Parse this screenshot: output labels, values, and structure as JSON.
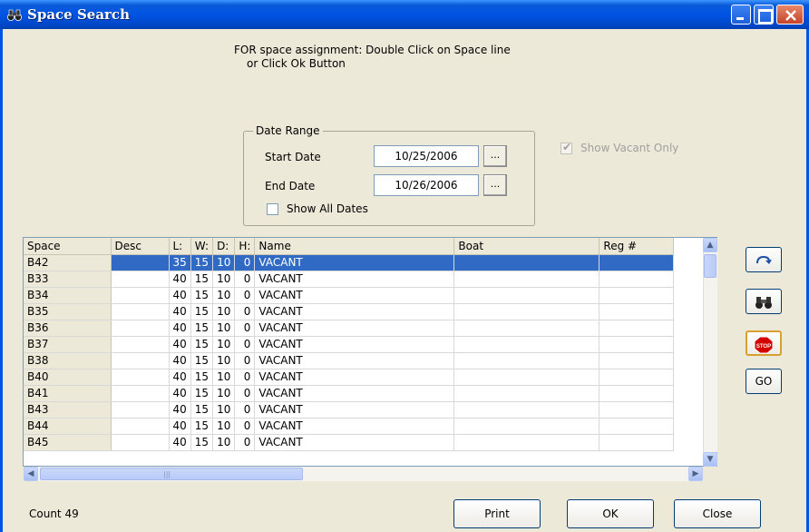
{
  "window": {
    "title": "Space Search"
  },
  "instructions": {
    "line1": "FOR space assignment: Double Click on Space line",
    "line2": "or Click Ok Button"
  },
  "date_range": {
    "legend": "Date Range",
    "start_label": "Start Date",
    "start_value": "10/25/2006",
    "end_label": "End Date",
    "end_value": "10/26/2006",
    "picker_label": "...",
    "show_all_dates_label": "Show All Dates",
    "show_all_dates_checked": false
  },
  "show_vacant_only": {
    "label": "Show Vacant Only",
    "checked": true,
    "disabled": true
  },
  "grid": {
    "columns": [
      "Space",
      "Desc",
      "L:",
      "W:",
      "D:",
      "H:",
      "Name",
      "Boat",
      "Reg #"
    ],
    "selected_row": 0,
    "rows": [
      [
        "B42",
        "",
        "35",
        "15",
        "10",
        "0",
        "VACANT",
        "",
        ""
      ],
      [
        "B33",
        "",
        "40",
        "15",
        "10",
        "0",
        "VACANT",
        "",
        ""
      ],
      [
        "B34",
        "",
        "40",
        "15",
        "10",
        "0",
        "VACANT",
        "",
        ""
      ],
      [
        "B35",
        "",
        "40",
        "15",
        "10",
        "0",
        "VACANT",
        "",
        ""
      ],
      [
        "B36",
        "",
        "40",
        "15",
        "10",
        "0",
        "VACANT",
        "",
        ""
      ],
      [
        "B37",
        "",
        "40",
        "15",
        "10",
        "0",
        "VACANT",
        "",
        ""
      ],
      [
        "B38",
        "",
        "40",
        "15",
        "10",
        "0",
        "VACANT",
        "",
        ""
      ],
      [
        "B40",
        "",
        "40",
        "15",
        "10",
        "0",
        "VACANT",
        "",
        ""
      ],
      [
        "B41",
        "",
        "40",
        "15",
        "10",
        "0",
        "VACANT",
        "",
        ""
      ],
      [
        "B43",
        "",
        "40",
        "15",
        "10",
        "0",
        "VACANT",
        "",
        ""
      ],
      [
        "B44",
        "",
        "40",
        "15",
        "10",
        "0",
        "VACANT",
        "",
        ""
      ],
      [
        "B45",
        "",
        "40",
        "15",
        "10",
        "0",
        "VACANT",
        "",
        ""
      ]
    ]
  },
  "side_buttons": {
    "refresh_icon": "refresh-icon",
    "search_icon": "binoculars-icon",
    "stop_icon": "stop-sign-icon",
    "stop_text": "STOP",
    "go_label": "GO"
  },
  "footer": {
    "count_label": "Count 49",
    "print_label": "Print",
    "ok_label": "OK",
    "close_label": "Close"
  },
  "colors": {
    "titlebar": "#0054e3",
    "selection": "#316ac5",
    "window_bg": "#ece9d8",
    "stop_red": "#d40000"
  }
}
